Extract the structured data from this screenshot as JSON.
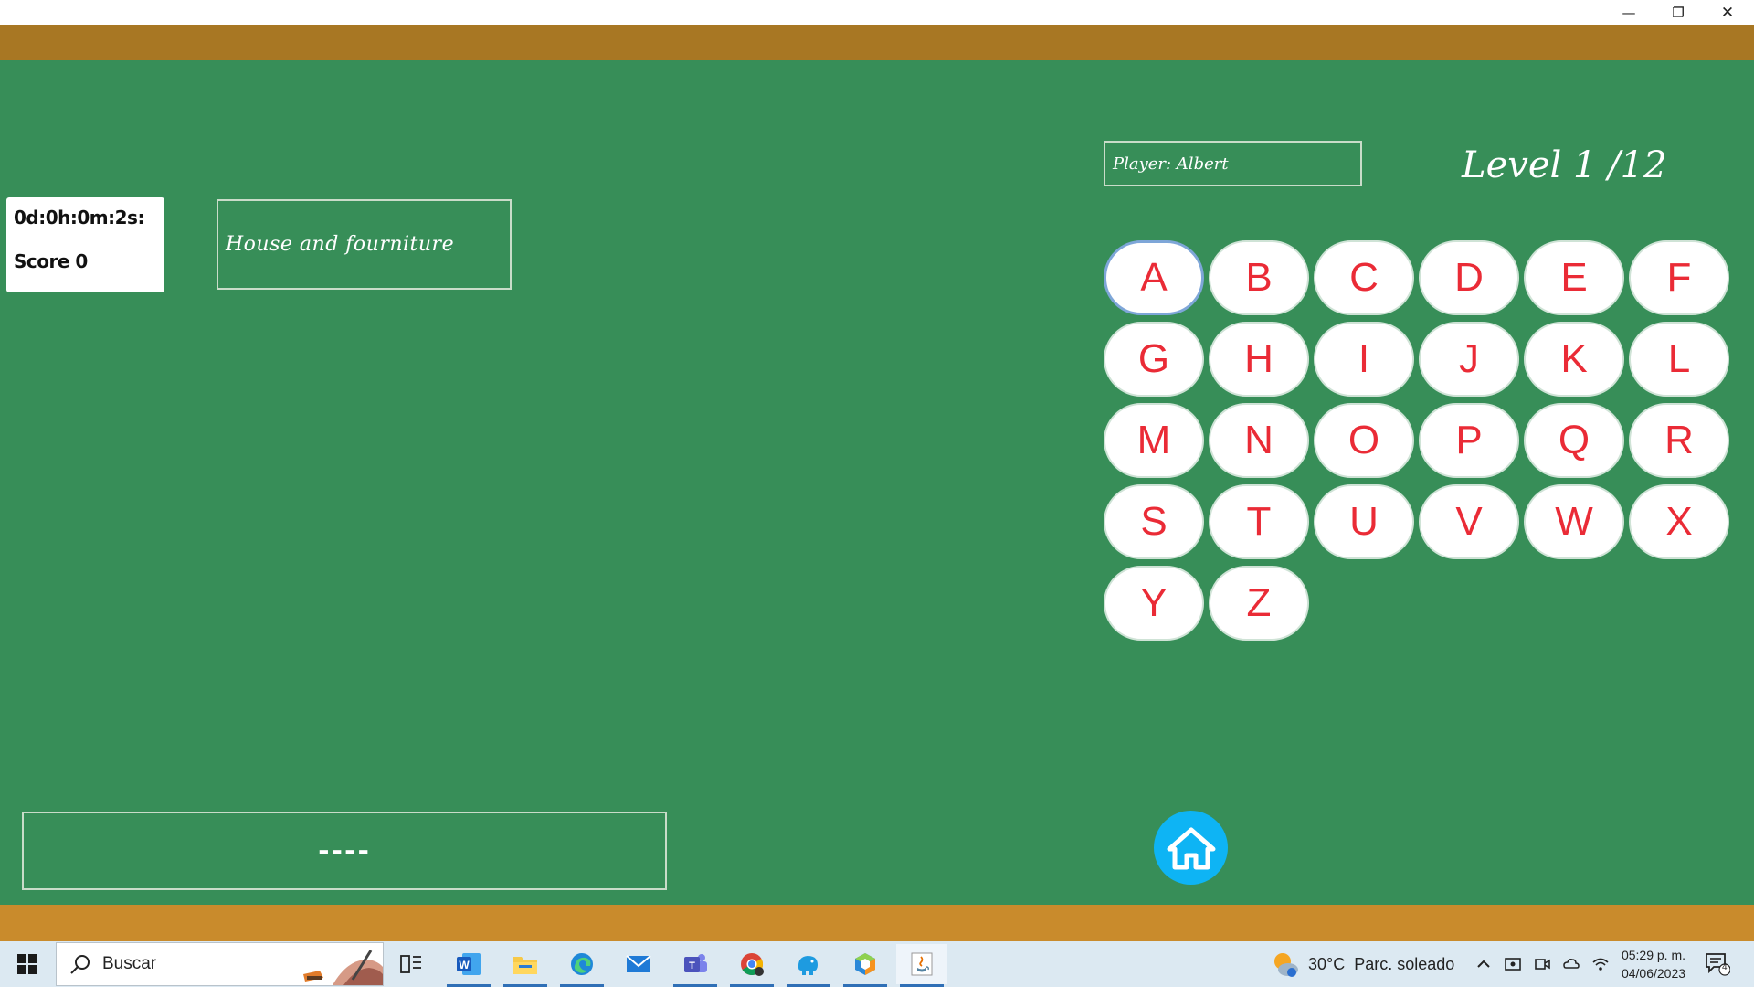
{
  "window": {
    "minimize_glyph": "—",
    "maximize_glyph": "❐",
    "close_glyph": "✕"
  },
  "game": {
    "timer": "0d:0h:0m:2s:",
    "score": "Score 0",
    "category": "House and fourniture",
    "player": "Player: Albert",
    "level": "Level 1 /12",
    "hidden_word": "----",
    "keys": [
      "A",
      "B",
      "C",
      "D",
      "E",
      "F",
      "G",
      "H",
      "I",
      "J",
      "K",
      "L",
      "M",
      "N",
      "O",
      "P",
      "Q",
      "R",
      "S",
      "T",
      "U",
      "V",
      "W",
      "X",
      "Y",
      "Z"
    ],
    "focused_key": "A",
    "colors": {
      "board": "#378e58",
      "wood_top": "#a87723",
      "wood_bottom": "#c98b2c",
      "key_letter": "#ea2b36",
      "home_button": "#0eb4f4"
    }
  },
  "taskbar": {
    "search_placeholder": "Buscar",
    "apps": [
      {
        "name": "task-view-icon"
      },
      {
        "name": "word-icon"
      },
      {
        "name": "file-explorer-icon"
      },
      {
        "name": "edge-icon"
      },
      {
        "name": "mail-icon"
      },
      {
        "name": "teams-icon"
      },
      {
        "name": "chrome-icon"
      },
      {
        "name": "elephant-app-icon"
      },
      {
        "name": "cube-app-icon"
      },
      {
        "name": "java-icon"
      }
    ],
    "weather_temp": "30°C",
    "weather_desc": "Parc. soleado",
    "time": "05:29 p. m.",
    "date": "04/06/2023",
    "notification_count": "4"
  }
}
